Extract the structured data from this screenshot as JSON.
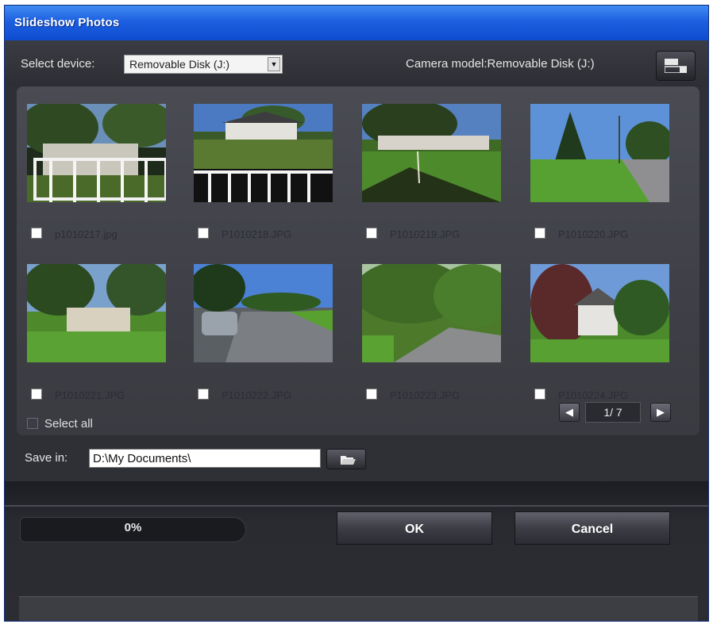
{
  "window": {
    "title": "Slideshow Photos"
  },
  "device": {
    "label": "Select device:",
    "selected": "Removable Disk (J:)",
    "camera_model_text": "Camera model:Removable Disk (J:)"
  },
  "photos": [
    {
      "name": "p1010217.jpg"
    },
    {
      "name": "P1010218.JPG"
    },
    {
      "name": "P1010219.JPG"
    },
    {
      "name": "P1010220.JPG"
    },
    {
      "name": "P1010221.JPG"
    },
    {
      "name": "P1010222.JPG"
    },
    {
      "name": "P1010223.JPG"
    },
    {
      "name": "P1010224.JPG"
    }
  ],
  "select_all": {
    "label": "Select all"
  },
  "pager": {
    "current": 1,
    "total": 7,
    "text": "1/ 7"
  },
  "save": {
    "label": "Save in:",
    "path": "D:\\My Documents\\"
  },
  "progress": {
    "percent_text": "0%",
    "value": 0
  },
  "buttons": {
    "ok": "OK",
    "cancel": "Cancel"
  },
  "icons": {
    "camera_button": "camera-view-icon",
    "browse": "folder-icon",
    "prev": "arrow-left-icon",
    "next": "arrow-right-icon",
    "dropdown": "chevron-down-icon"
  }
}
